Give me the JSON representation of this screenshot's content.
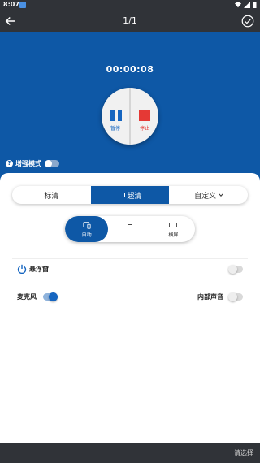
{
  "status_bar": {
    "time": "8:07",
    "icons": [
      "notification-icon",
      "wifi-icon",
      "signal-icon",
      "battery-icon"
    ]
  },
  "app_bar": {
    "title": "1/1",
    "back_icon": "arrow-left-icon",
    "confirm_icon": "check-circle-icon"
  },
  "recorder": {
    "timer": "00:00:08",
    "pause_label": "暂停",
    "stop_label": "停止",
    "enhance_label": "增强模式",
    "enhance_on": false
  },
  "quality": {
    "options": [
      "标清",
      "超清",
      "自定义"
    ],
    "selected": "超清"
  },
  "orientation": {
    "options": [
      {
        "label": "自动",
        "icon": "auto-rotate-icon"
      },
      {
        "label": "",
        "icon": "portrait-icon"
      },
      {
        "label": "横屏",
        "icon": "landscape-icon"
      }
    ],
    "selected": "自动"
  },
  "floating_window": {
    "label": "悬浮窗",
    "on": false
  },
  "microphone": {
    "label": "麦克风",
    "on": true
  },
  "internal_audio": {
    "label": "内部声音",
    "on": false
  },
  "bottom_bar": {
    "select_label": "请选择"
  },
  "colors": {
    "primary": "#0e58a6",
    "stop": "#e53935",
    "dark_bar": "#303338"
  }
}
